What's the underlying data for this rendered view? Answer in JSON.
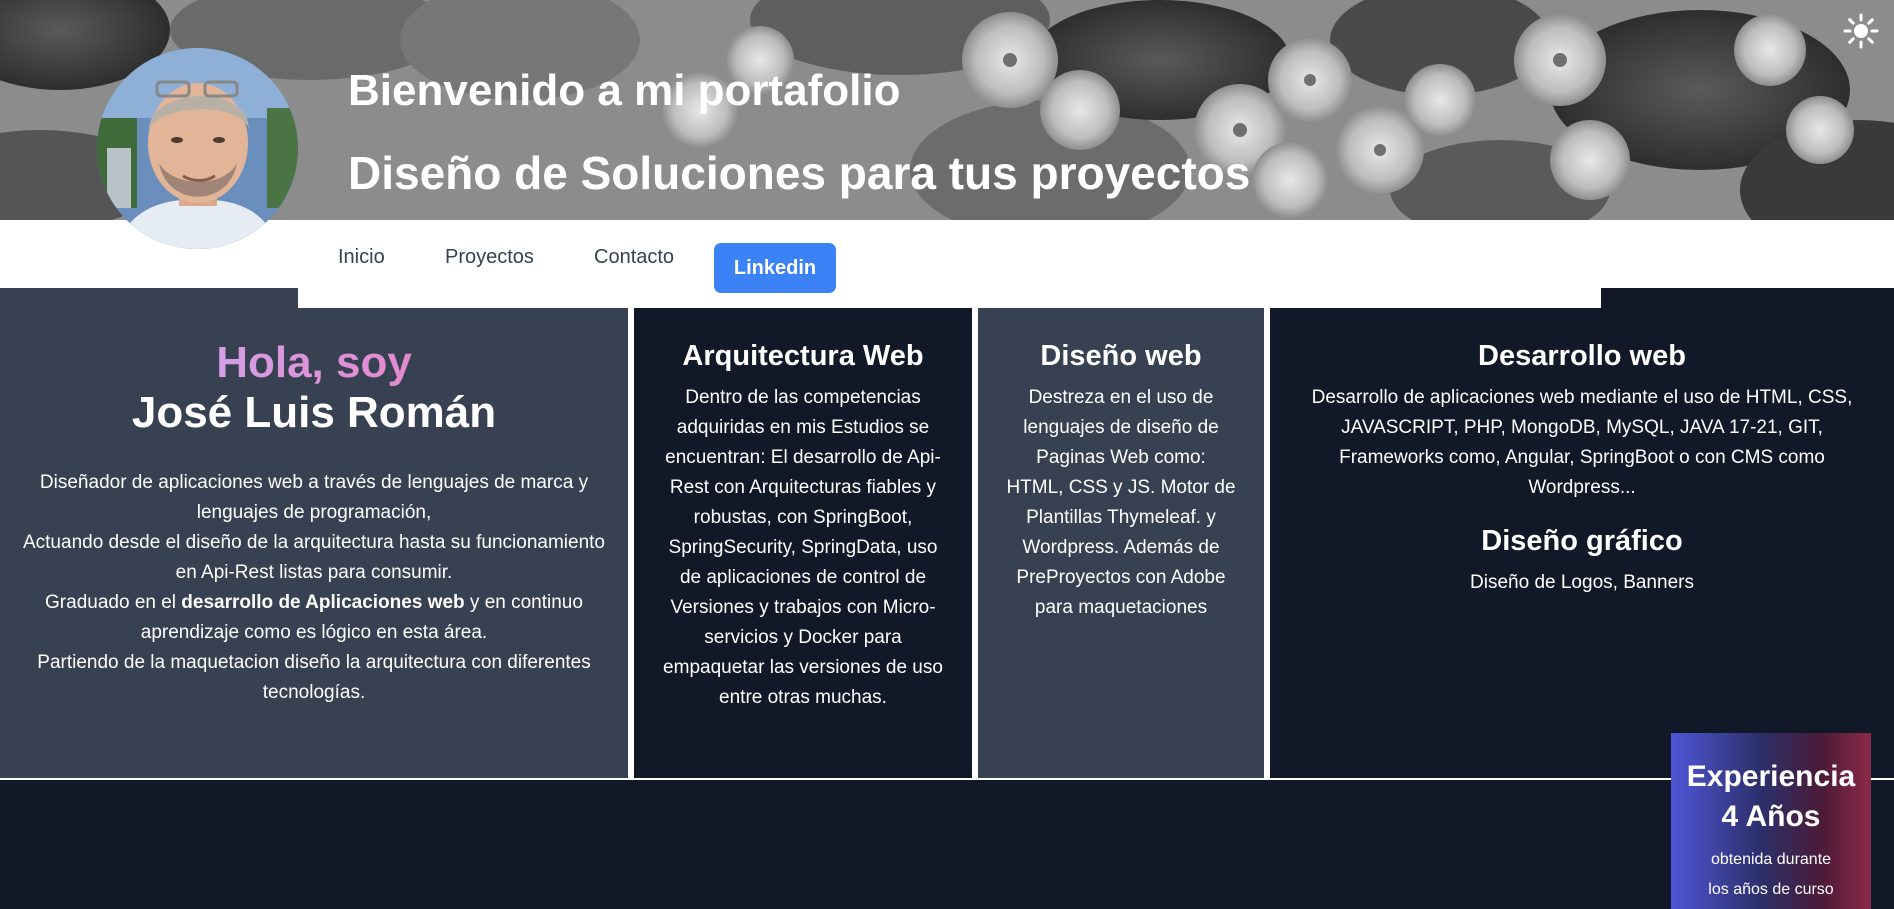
{
  "header": {
    "title": "Bienvenido a mi portafolio",
    "subtitle": "Diseño de Soluciones para tus proyectos",
    "theme_toggle_icon": "sun-icon"
  },
  "nav": {
    "items": [
      "Inicio",
      "Proyectos",
      "Contacto"
    ],
    "linkedin_label": "Linkedin"
  },
  "intro": {
    "greeting": "Hola, soy",
    "name": "José Luis Román",
    "paragraph_1": "Diseñador de aplicaciones web a través de lenguajes de marca y lenguajes de programación,",
    "paragraph_2": "Actuando desde el diseño de la arquitectura hasta su funcionamiento en Api-Rest listas para consumir.",
    "paragraph_3_before": "Graduado en el ",
    "paragraph_3_bold": "desarrollo de Aplicaciones web",
    "paragraph_3_after": " y en continuo aprendizaje como es lógico en esta área.",
    "paragraph_4": "Partiendo de la maquetacion diseño la arquitectura con diferentes tecnologías."
  },
  "cards": {
    "arquitectura": {
      "title": "Arquitectura Web",
      "text": "Dentro de las competencias adquiridas en mis Estudios se encuentran: El desarrollo de Api-Rest con Arquitecturas fiables y robustas, con SpringBoot, SpringSecurity, SpringData, uso de aplicaciones de control de Versiones y trabajos con Micro-servicios y Docker para empaquetar las versiones de uso entre otras muchas."
    },
    "diseno": {
      "title": "Diseño web",
      "text": "Destreza en el uso de lenguajes de diseño de Paginas Web como: HTML, CSS y JS. Motor de Plantillas Thymeleaf. y Wordpress. Además de PreProyectos con Adobe para maquetaciones"
    },
    "desarrollo": {
      "title": "Desarrollo web",
      "text": "Desarrollo de aplicaciones web mediante el uso de HTML, CSS, JAVASCRIPT, PHP, MongoDB, MySQL, JAVA 17-21, GIT, Frameworks como, Angular, SpringBoot o con CMS como Wordpress..."
    },
    "grafico": {
      "title": "Diseño gráfico",
      "text": "Diseño de Logos, Banners"
    }
  },
  "experience": {
    "title": "Experiencia",
    "years": "4 Años",
    "line_1": "obtenida durante",
    "line_2": "los años de curso"
  },
  "colors": {
    "greeting_gradient_start": "#c4b5fd",
    "greeting_gradient_end": "#f472b6",
    "linkedin_button": "#3b82f6",
    "card_light": "#374151",
    "card_dark": "#111827"
  }
}
